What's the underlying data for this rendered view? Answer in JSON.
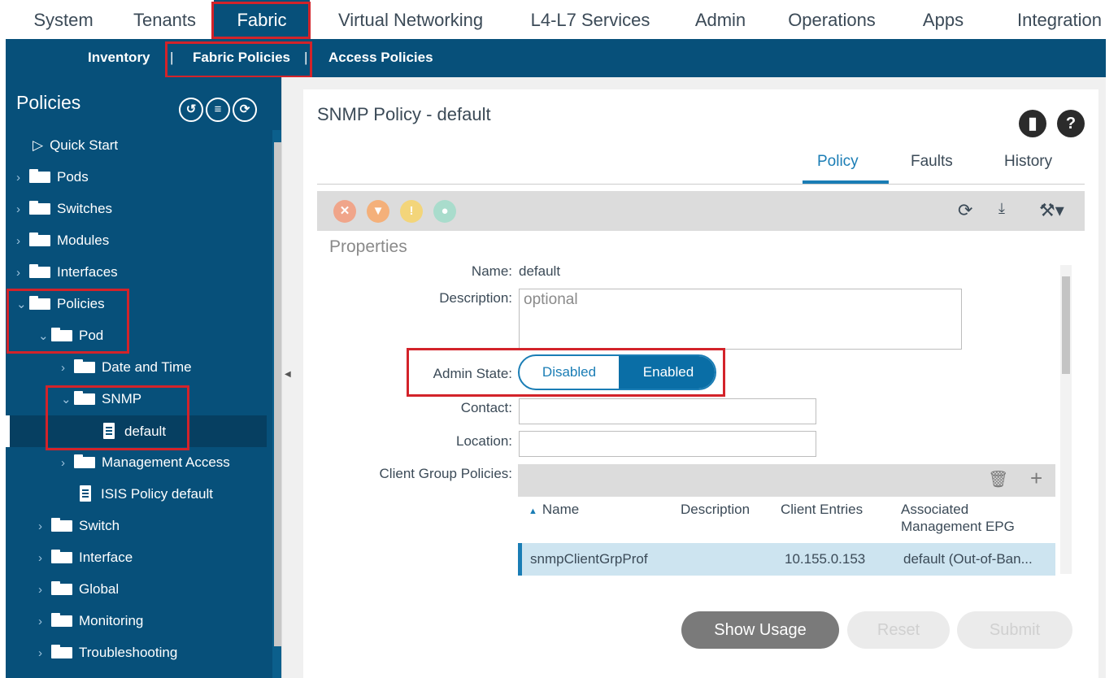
{
  "top_nav": {
    "tabs": [
      "System",
      "Tenants",
      "Fabric",
      "Virtual Networking",
      "L4-L7 Services",
      "Admin",
      "Operations",
      "Apps",
      "Integration"
    ],
    "active": "Fabric"
  },
  "sub_nav": {
    "items": [
      "Inventory",
      "Fabric Policies",
      "Access Policies"
    ],
    "separator": "|"
  },
  "sidebar": {
    "title": "Policies",
    "header_icons": [
      "tour-icon",
      "list-filter-icon",
      "refresh-icon"
    ],
    "tree": [
      {
        "label": "Quick Start",
        "icon": "play-circle-icon"
      },
      {
        "label": "Pods",
        "icon": "folder-icon"
      },
      {
        "label": "Switches",
        "icon": "folder-icon"
      },
      {
        "label": "Modules",
        "icon": "folder-icon"
      },
      {
        "label": "Interfaces",
        "icon": "folder-icon"
      },
      {
        "label": "Policies",
        "icon": "folder-icon"
      },
      {
        "label": "Pod",
        "icon": "folder-icon"
      },
      {
        "label": "Date and Time",
        "icon": "folder-icon"
      },
      {
        "label": "SNMP",
        "icon": "folder-icon"
      },
      {
        "label": "default",
        "icon": "document-icon"
      },
      {
        "label": "Management Access",
        "icon": "folder-icon"
      },
      {
        "label": "ISIS Policy default",
        "icon": "document-icon"
      },
      {
        "label": "Switch",
        "icon": "folder-icon"
      },
      {
        "label": "Interface",
        "icon": "folder-icon"
      },
      {
        "label": "Global",
        "icon": "folder-icon"
      },
      {
        "label": "Monitoring",
        "icon": "folder-icon"
      },
      {
        "label": "Troubleshooting",
        "icon": "folder-icon"
      }
    ]
  },
  "panel": {
    "title": "SNMP Policy - default",
    "tabs": [
      "Policy",
      "Faults",
      "History"
    ],
    "active_tab": "Policy",
    "section": "Properties",
    "form": {
      "name_label": "Name:",
      "name_value": "default",
      "description_label": "Description:",
      "description_placeholder": "optional",
      "admin_state_label": "Admin State:",
      "admin_state_options": [
        "Disabled",
        "Enabled"
      ],
      "admin_state_selected": "Enabled",
      "contact_label": "Contact:",
      "location_label": "Location:",
      "client_group_label": "Client Group Policies:"
    },
    "table": {
      "columns": [
        "Name",
        "Description",
        "Client Entries",
        "Associated",
        "Management EPG"
      ],
      "rows": [
        {
          "name": "snmpClientGrpProf",
          "description": "",
          "client_entries": "10.155.0.153",
          "epg": "default (Out-of-Ban..."
        }
      ]
    },
    "buttons": {
      "show_usage": "Show Usage",
      "reset": "Reset",
      "submit": "Submit"
    }
  },
  "colors": {
    "nav_blue": "#07507a",
    "accent": "#1a7db5",
    "highlight_red": "#d3232a"
  }
}
